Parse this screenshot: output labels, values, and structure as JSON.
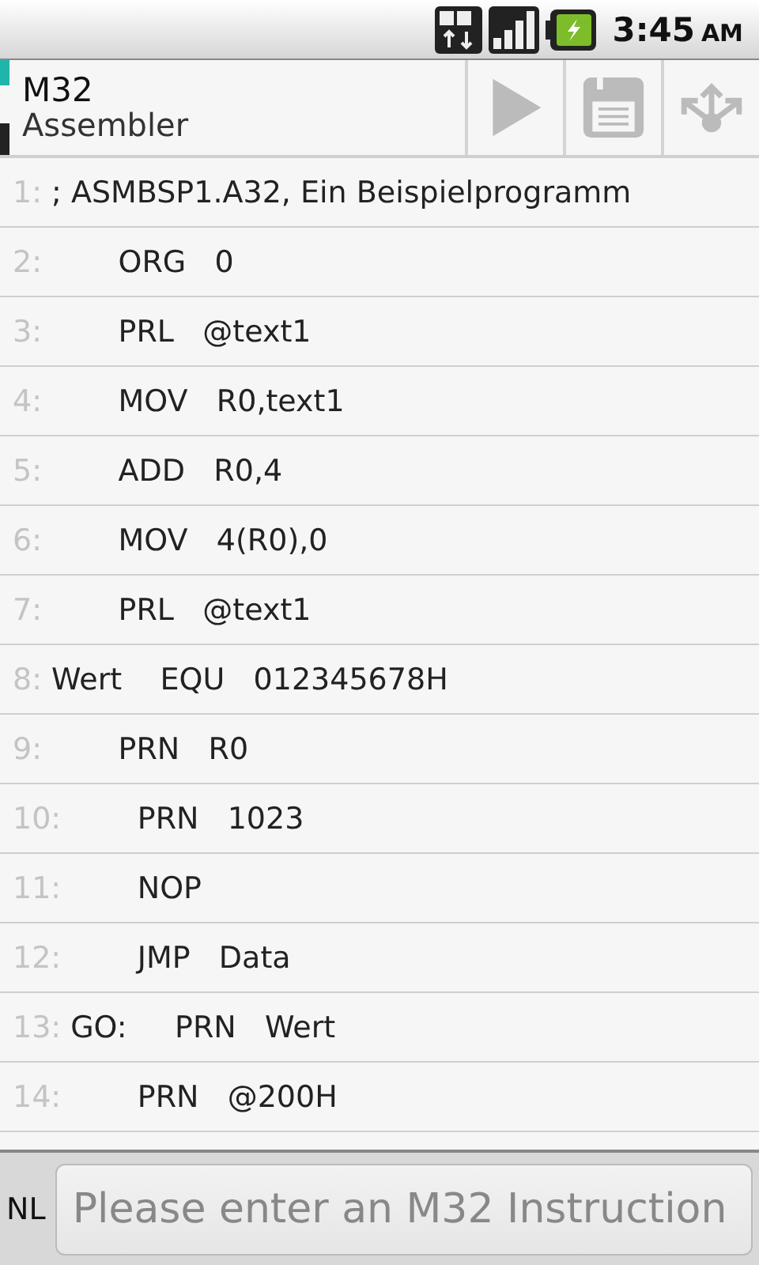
{
  "status_bar": {
    "time": "3:45",
    "ampm": "AM"
  },
  "action_bar": {
    "title": "M32",
    "subtitle": "Assembler",
    "actions": [
      {
        "kind": "run",
        "disabled": true
      },
      {
        "kind": "save",
        "disabled": true
      },
      {
        "kind": "share",
        "disabled": true
      }
    ]
  },
  "code_lines": [
    {
      "number": "1:",
      "text": "; ASMBSP1.A32, Ein Beispielprogramm"
    },
    {
      "number": "2:",
      "text": "       ORG   0"
    },
    {
      "number": "3:",
      "text": "       PRL   @text1"
    },
    {
      "number": "4:",
      "text": "       MOV   R0,text1"
    },
    {
      "number": "5:",
      "text": "       ADD   R0,4"
    },
    {
      "number": "6:",
      "text": "       MOV   4(R0),0"
    },
    {
      "number": "7:",
      "text": "       PRL   @text1"
    },
    {
      "number": "8:",
      "text": "Wert    EQU   012345678H"
    },
    {
      "number": "9:",
      "text": "       PRN   R0"
    },
    {
      "number": "10:",
      "text": "       PRN   1023"
    },
    {
      "number": "11:",
      "text": "       NOP"
    },
    {
      "number": "12:",
      "text": "       JMP   Data"
    },
    {
      "number": "13:",
      "text": "GO:     PRN   Wert"
    },
    {
      "number": "14:",
      "text": "       PRN   @200H"
    }
  ],
  "input_bar": {
    "label": "NL",
    "placeholder": "Please enter an M32 Instruction"
  }
}
